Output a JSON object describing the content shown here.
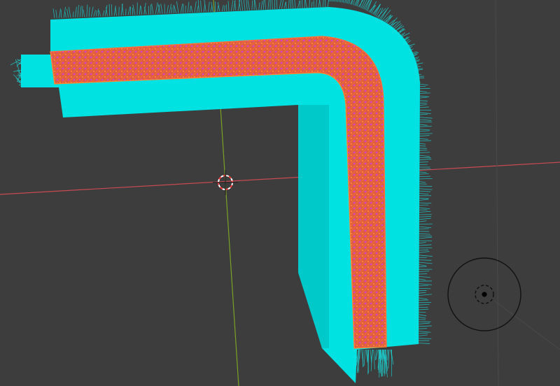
{
  "app": {
    "name": "3D Viewport",
    "hud_text": ""
  },
  "viewport": {
    "background_color": "#3d3d3d",
    "grid_line_color": "#4a4a4a",
    "x_axis_color": "#c84a52",
    "y_axis_color": "#7aa225"
  },
  "mesh": {
    "shape": "L-shaped bent pipe",
    "outer_color": "#00e1e1",
    "outer_shadow_color": "#00c9c9",
    "inner_color": "#e05a45",
    "vertex_color": "#d447c5",
    "edge_color": "#ff8a30",
    "normal_hair_color": "#1ec8c8"
  },
  "cursor_3d": {
    "name": "3d-cursor",
    "ring_color_a": "#ff3b3b",
    "ring_color_b": "#ffffff"
  },
  "navigation_gizmo": {
    "name": "view-navigation-gizmo",
    "ring_color": "#111111",
    "center_color": "#000000"
  }
}
